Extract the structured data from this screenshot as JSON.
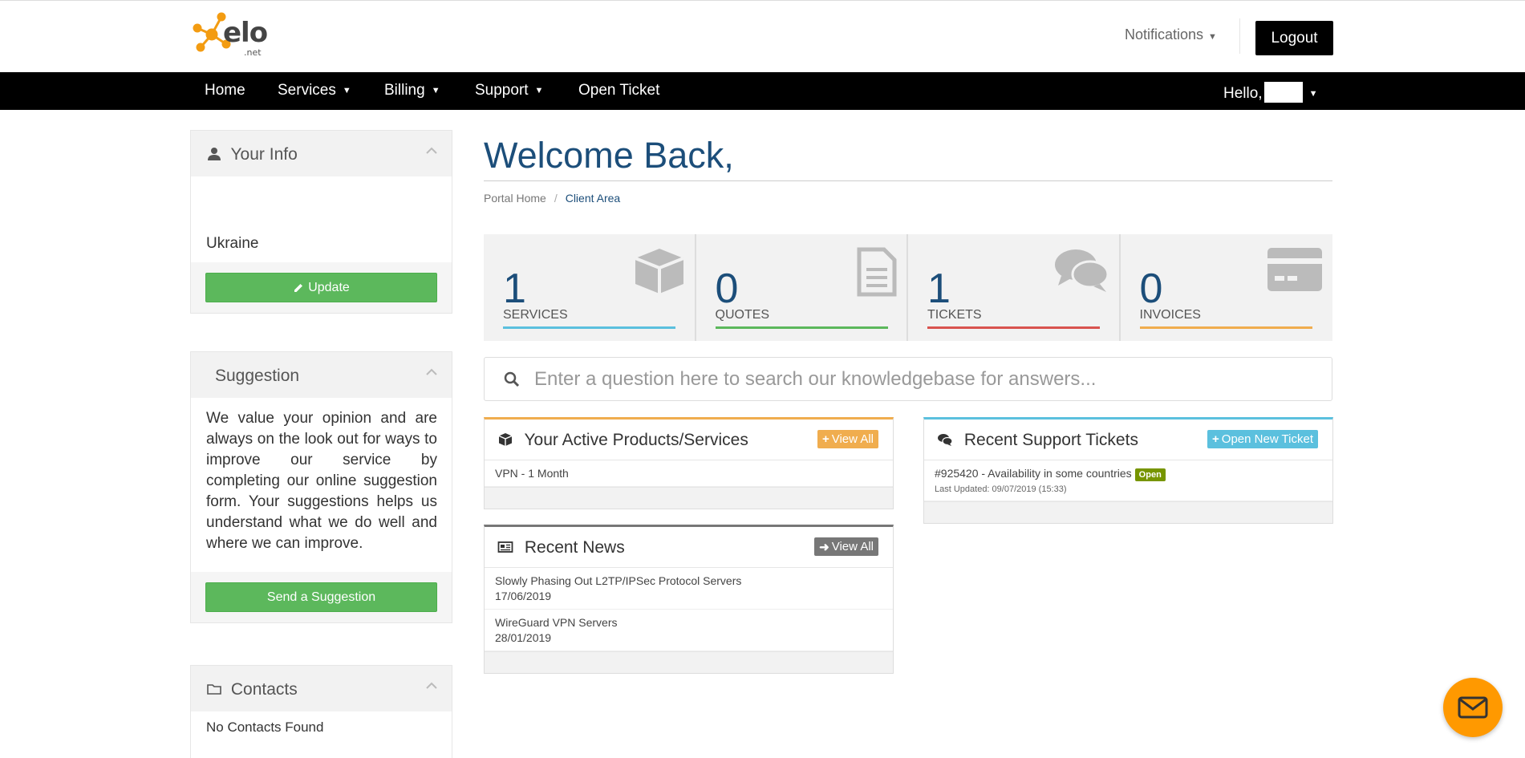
{
  "header": {
    "logo_word": "elo",
    "logo_sub": ".net",
    "notifications_label": "Notifications",
    "logout_label": "Logout"
  },
  "nav": {
    "home": "Home",
    "services": "Services",
    "billing": "Billing",
    "support": "Support",
    "open_ticket": "Open Ticket",
    "hello": "Hello,"
  },
  "sidebar": {
    "your_info": {
      "title": "Your Info",
      "country": "Ukraine",
      "update_label": "Update"
    },
    "suggestion": {
      "title": "Suggestion",
      "text": "We value your opinion and are always on the look out for ways to improve our service by completing our online suggestion form. Your suggestions helps us understand what we do well and where we can improve.",
      "button_label": "Send a Suggestion"
    },
    "contacts": {
      "title": "Contacts",
      "empty_text": "No Contacts Found"
    }
  },
  "main": {
    "title": "Welcome Back,",
    "breadcrumb": [
      "Portal Home",
      "Client Area"
    ],
    "stats": [
      {
        "value": "1",
        "label": "SERVICES",
        "color": "#5bc0de"
      },
      {
        "value": "0",
        "label": "QUOTES",
        "color": "#5cb85c"
      },
      {
        "value": "1",
        "label": "TICKETS",
        "color": "#d9534f"
      },
      {
        "value": "0",
        "label": "INVOICES",
        "color": "#f0ad4e"
      }
    ],
    "search_placeholder": "Enter a question here to search our knowledgebase for answers..."
  },
  "products_card": {
    "title": "Your Active Products/Services",
    "view_all_label": "View All",
    "items": [
      "VPN - 1 Month"
    ],
    "accent": "#f0ad4e"
  },
  "news_card": {
    "title": "Recent News",
    "view_all_label": "View All",
    "items": [
      {
        "title": "Slowly Phasing Out L2TP/IPSec Protocol Servers",
        "date": "17/06/2019"
      },
      {
        "title": "WireGuard VPN Servers",
        "date": "28/01/2019"
      }
    ],
    "accent": "#777777"
  },
  "tickets_card": {
    "title": "Recent Support Tickets",
    "open_new_label": "Open New Ticket",
    "items": [
      {
        "subject": "#925420 - Availability in some countries",
        "status": "Open",
        "updated": "Last Updated: 09/07/2019 (15:33)"
      }
    ],
    "accent": "#5bc0de"
  },
  "colors": {
    "brand_orange": "#f39c12",
    "primary_blue": "#1c4e7a",
    "green": "#5cb85c",
    "chat_orange": "#ff9900"
  }
}
